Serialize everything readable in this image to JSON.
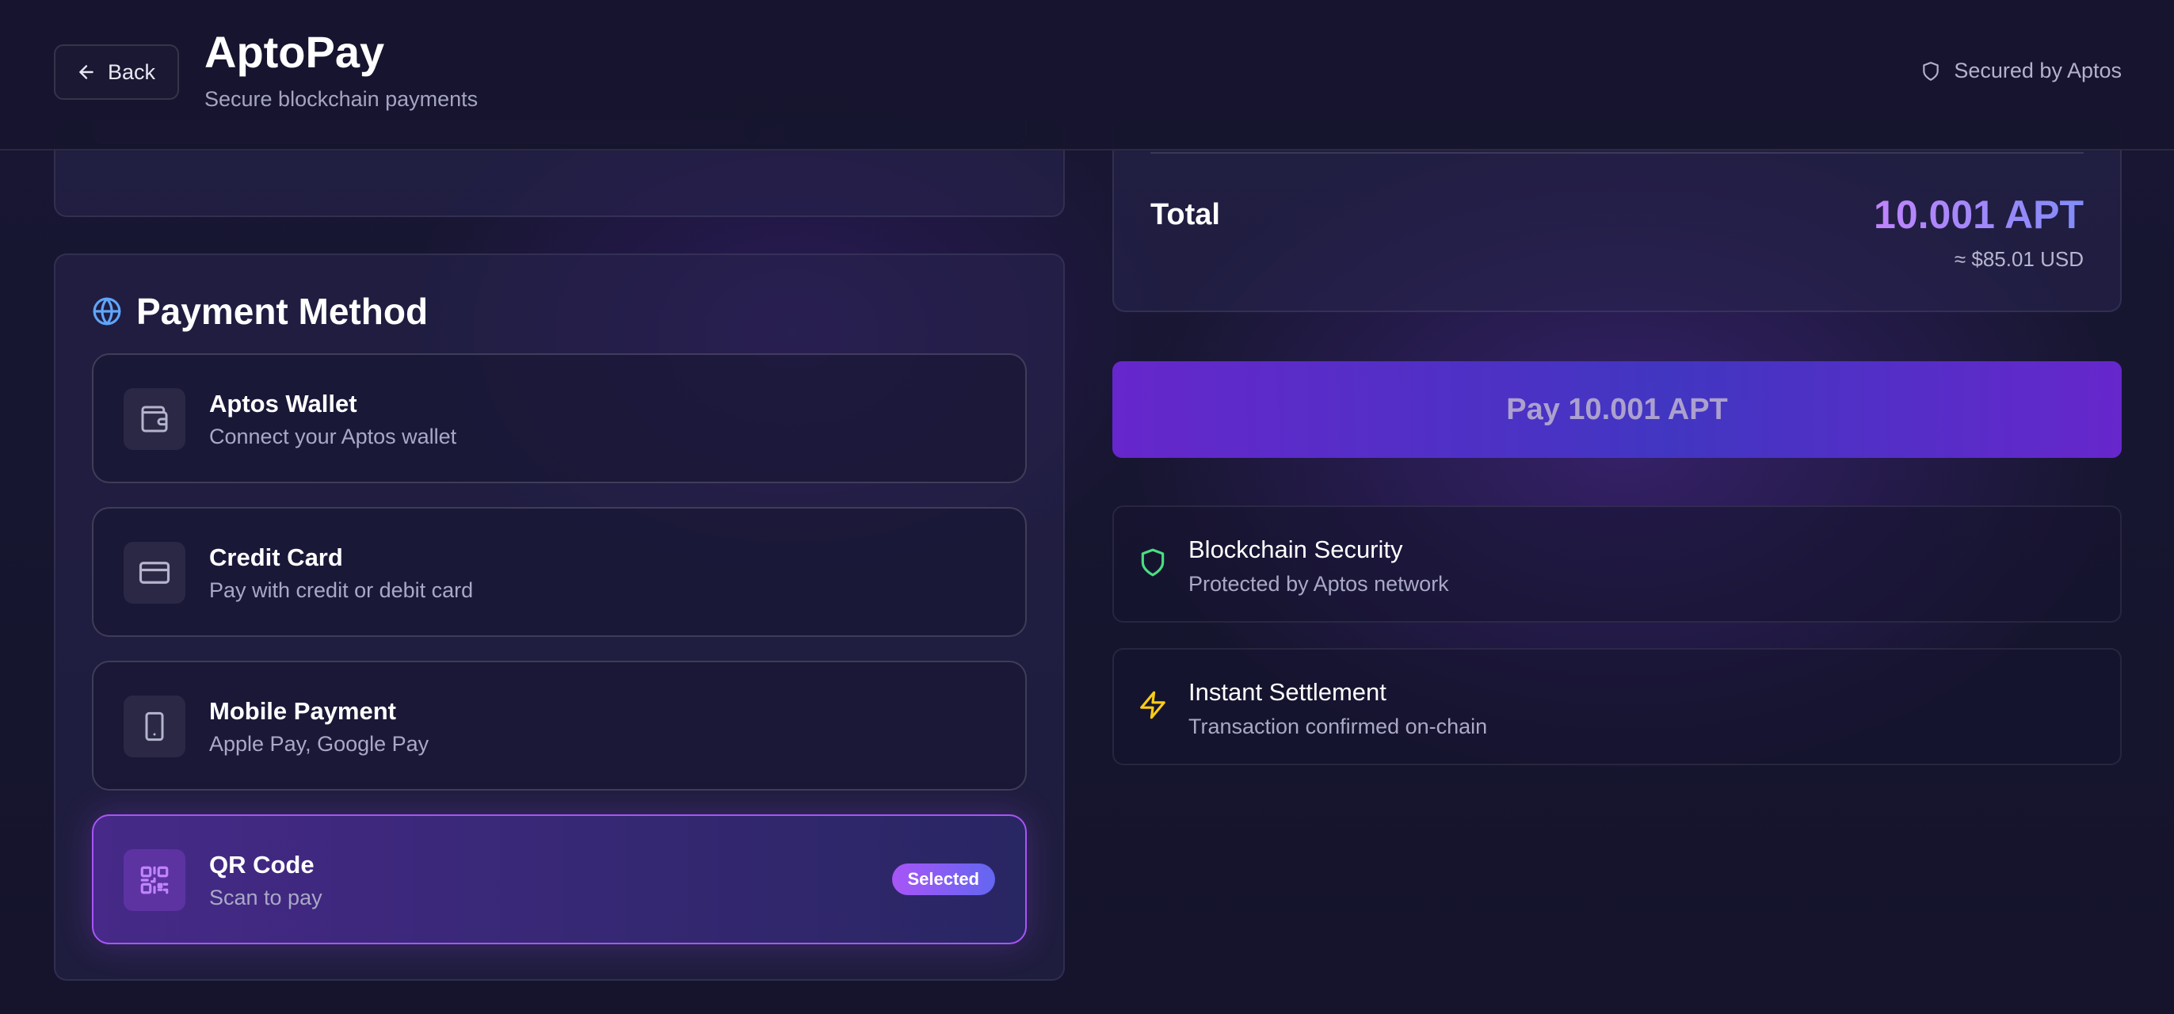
{
  "header": {
    "back_label": "Back",
    "title": "AptoPay",
    "subtitle": "Secure blockchain payments",
    "secured_label": "Secured by Aptos"
  },
  "payment_method": {
    "title": "Payment Method",
    "options": [
      {
        "title": "Aptos Wallet",
        "description": "Connect your Aptos wallet",
        "icon": "wallet-icon"
      },
      {
        "title": "Credit Card",
        "description": "Pay with credit or debit card",
        "icon": "credit-card-icon"
      },
      {
        "title": "Mobile Payment",
        "description": "Apple Pay, Google Pay",
        "icon": "smartphone-icon"
      },
      {
        "title": "QR Code",
        "description": "Scan to pay",
        "icon": "qr-code-icon",
        "selected": true
      }
    ],
    "selected_badge": "Selected"
  },
  "summary": {
    "total_label": "Total",
    "total_value": "10.001 APT",
    "total_usd": "≈ $85.01 USD"
  },
  "pay_button": {
    "label": "Pay 10.001 APT"
  },
  "features": [
    {
      "title": "Blockchain Security",
      "description": "Protected by Aptos network",
      "icon": "shield-icon",
      "color": "#4ade80"
    },
    {
      "title": "Instant Settlement",
      "description": "Transaction confirmed on-chain",
      "icon": "lightning-icon",
      "color": "#facc15"
    }
  ],
  "colors": {
    "accent": "#a855f7",
    "accent_secondary": "#6366f1",
    "background": "#15142c"
  }
}
